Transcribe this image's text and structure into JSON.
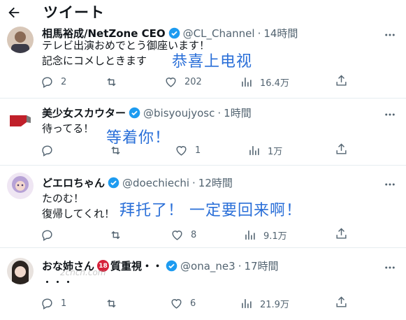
{
  "header": {
    "title": "ツイート"
  },
  "tweets": [
    {
      "display_name": "相馬裕成/NetZone CEO",
      "handle": "@CL_Channel",
      "time": "14時間",
      "body": [
        "テレビ出演おめでとう御座います！",
        "記念にコメしときます"
      ],
      "overlay": "恭喜上电视",
      "replies": "2",
      "retweets": "",
      "likes": "202",
      "views": "16.4万"
    },
    {
      "display_name": "美少女スカウター",
      "handle": "@bisyoujyosc",
      "time": "1時間",
      "body": [
        "待ってる！"
      ],
      "overlay": "等着你！",
      "replies": "",
      "retweets": "",
      "likes": "1",
      "views": "1万"
    },
    {
      "display_name": "どエロちゃん",
      "handle": "@doechiechi",
      "time": "12時間",
      "body": [
        "たのむ！",
        "復帰してくれ！"
      ],
      "overlay": "拜托了！ 一定要回来啊！",
      "replies": "",
      "retweets": "",
      "likes": "8",
      "views": "9.1万"
    },
    {
      "display_name": "おな姉さん",
      "display_name_suffix": "質重視・・",
      "age_badge": "18",
      "handle": "@ona_ne3",
      "time": "17時間",
      "body": [
        "・・・"
      ],
      "replies": "1",
      "retweets": "",
      "likes": "6",
      "views": "21.9万"
    }
  ],
  "watermark": "2chcn.com",
  "colors": {
    "accent": "#1d9bf0",
    "overlay": "#2a6fd8",
    "muted": "#536471",
    "divider": "#e6ecf0"
  }
}
